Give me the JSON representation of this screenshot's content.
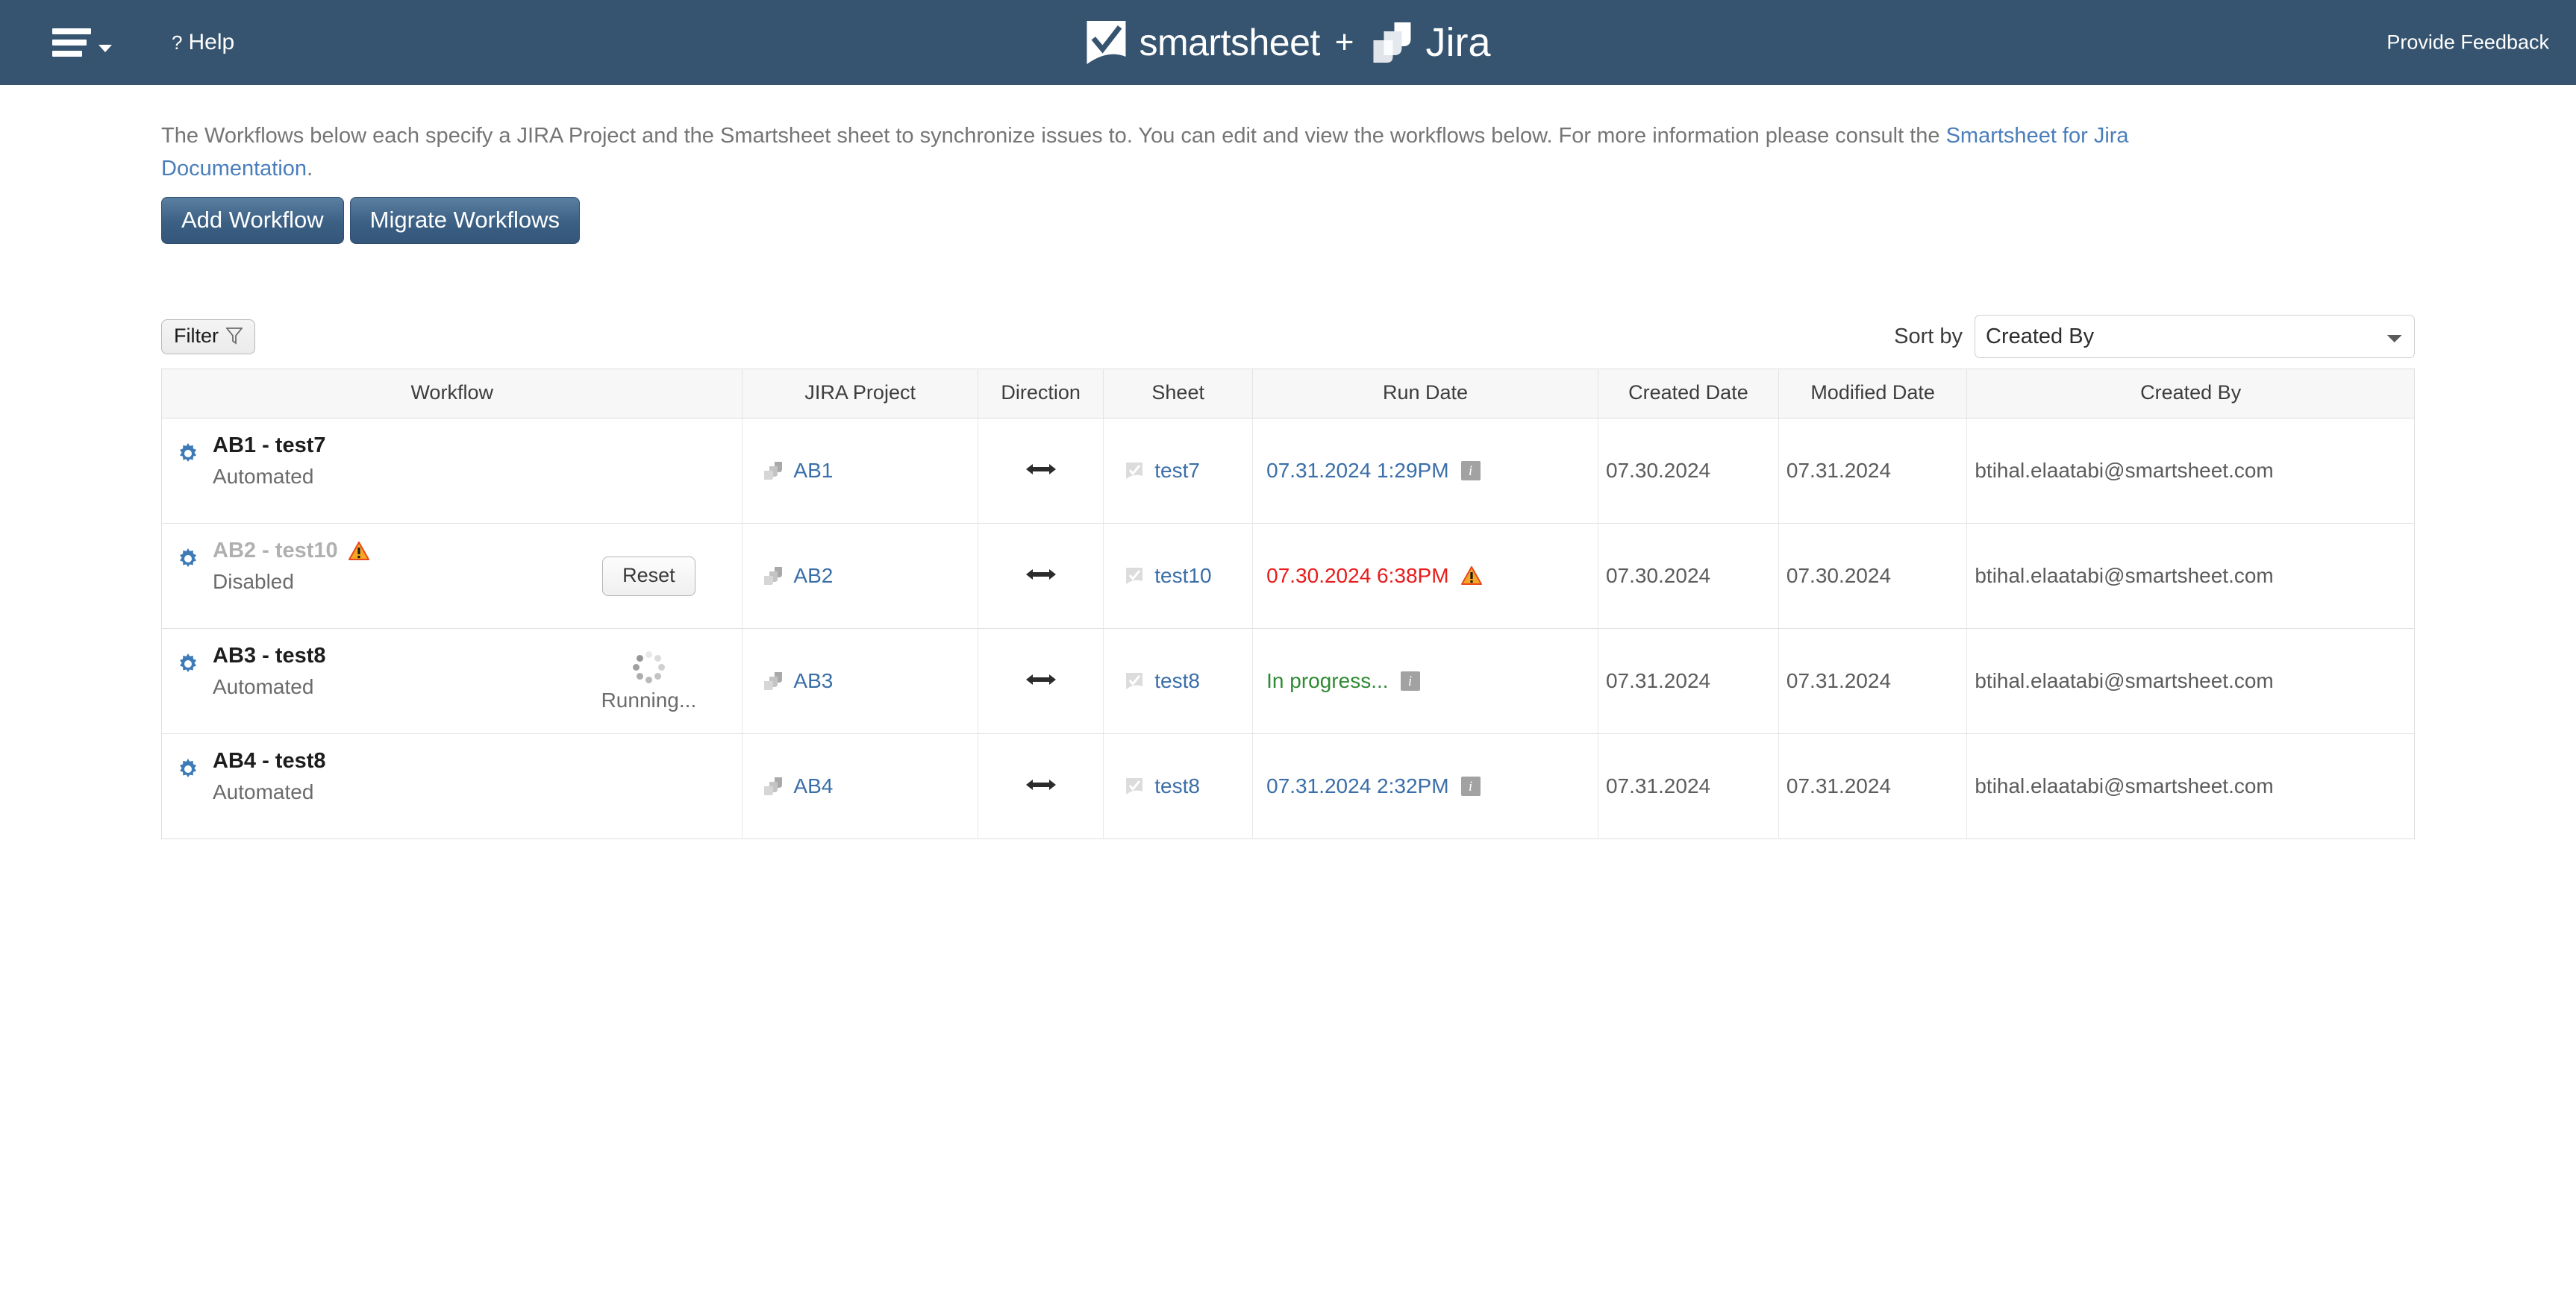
{
  "header": {
    "menu_icon": "hamburger-icon",
    "help_label": "Help",
    "help_icon": "question-mark-icon",
    "logo_text_smartsheet": "smartsheet",
    "logo_plus": "+",
    "logo_text_jira": "Jira",
    "feedback_label": "Provide Feedback",
    "background_color": "#36546f"
  },
  "intro": {
    "text_before_link": "The Workflows below each specify a JIRA Project and the Smartsheet sheet to synchronize issues to. You can edit and view the workflows below. For more information please consult the ",
    "link_label": "Smartsheet for Jira Documentation",
    "text_after_link": "."
  },
  "actions": {
    "add_workflow_label": "Add Workflow",
    "migrate_workflows_label": "Migrate Workflows"
  },
  "toolbar": {
    "filter_label": "Filter",
    "filter_icon": "funnel-icon",
    "sort_label": "Sort by",
    "sort_value": "Created By",
    "sort_options": [
      "Created By"
    ]
  },
  "table": {
    "columns": [
      "Workflow",
      "JIRA Project",
      "Direction",
      "Sheet",
      "Run Date",
      "Created Date",
      "Modified Date",
      "Created By"
    ],
    "rows": [
      {
        "workflow_title": "AB1 - test7",
        "workflow_status": "Automated",
        "disabled": false,
        "warning": false,
        "aside": "none",
        "jira_project": "AB1",
        "direction": "bidirectional",
        "sheet": "test7",
        "run_date": "07.31.2024 1:29PM",
        "run_state": "blue",
        "run_icon": "info-icon",
        "created_date": "07.30.2024",
        "modified_date": "07.31.2024",
        "created_by": "btihal.elaatabi@smartsheet.com"
      },
      {
        "workflow_title": "AB2 - test10",
        "workflow_status": "Disabled",
        "disabled": true,
        "warning": true,
        "aside": "reset",
        "aside_label": "Reset",
        "jira_project": "AB2",
        "direction": "bidirectional",
        "sheet": "test10",
        "run_date": "07.30.2024 6:38PM",
        "run_state": "red",
        "run_icon": "warning-icon",
        "created_date": "07.30.2024",
        "modified_date": "07.30.2024",
        "created_by": "btihal.elaatabi@smartsheet.com"
      },
      {
        "workflow_title": "AB3 - test8",
        "workflow_status": "Automated",
        "disabled": false,
        "warning": false,
        "aside": "spinner",
        "aside_label": "Running...",
        "jira_project": "AB3",
        "direction": "bidirectional",
        "sheet": "test8",
        "run_date": "In progress...",
        "run_state": "green",
        "run_icon": "info-icon",
        "created_date": "07.31.2024",
        "modified_date": "07.31.2024",
        "created_by": "btihal.elaatabi@smartsheet.com"
      },
      {
        "workflow_title": "AB4 - test8",
        "workflow_status": "Automated",
        "disabled": false,
        "warning": false,
        "aside": "none",
        "jira_project": "AB4",
        "direction": "bidirectional",
        "sheet": "test8",
        "run_date": "07.31.2024 2:32PM",
        "run_state": "blue",
        "run_icon": "info-icon",
        "created_date": "07.31.2024",
        "modified_date": "07.31.2024",
        "created_by": "btihal.elaatabi@smartsheet.com"
      }
    ]
  },
  "colors": {
    "header_bg": "#36546f",
    "link_blue": "#3a6ea8",
    "error_red": "#e81c1c",
    "success_green": "#2f8a34",
    "gear_blue": "#3d7ab8",
    "warning_orange": "#f5a623"
  }
}
